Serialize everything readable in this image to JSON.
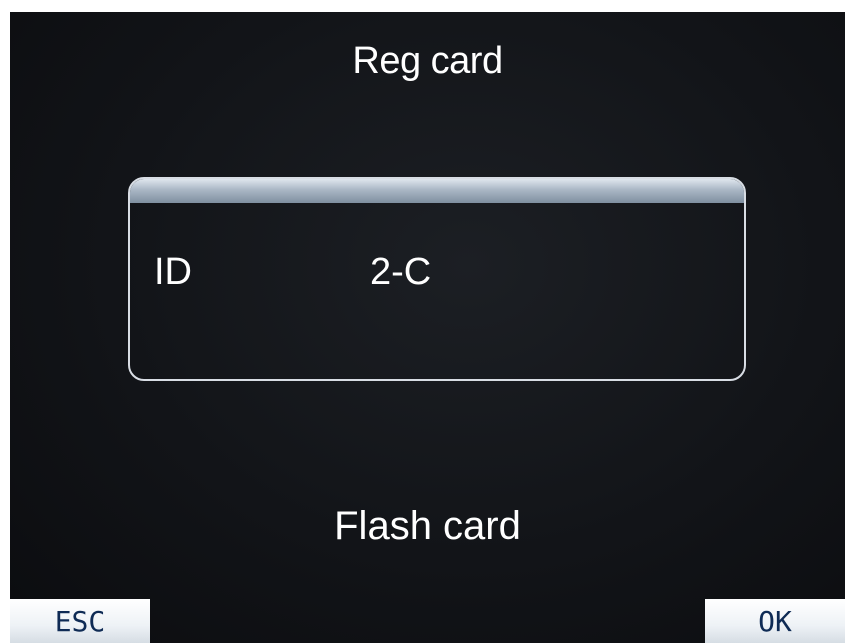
{
  "screen": {
    "title": "Reg card",
    "prompt": "Flash card"
  },
  "card_info": {
    "id_label": "ID",
    "id_value": "2-C"
  },
  "softkeys": {
    "esc_label": "ESC",
    "ok_label": "OK"
  },
  "colors": {
    "background": "#121418",
    "text": "#ffffff",
    "box_border": "#d8dde4",
    "softkey_text": "#0f2b55"
  }
}
